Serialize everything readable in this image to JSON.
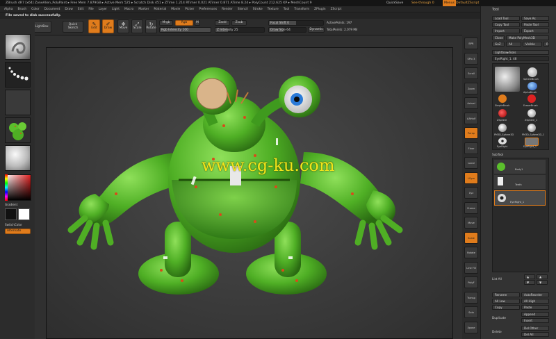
{
  "title_bar": {
    "text": "ZBrush 4R7 [x64]     ZoneAlien_PolyPaint     ▸ Free Mem 7.879GB ▸ Active Mem 525 ▸ Scratch Disk 451 ▸ ZTime 1.214 RTimer 0.021 ATimer 0.871 ATime 8.24 ▸ PolyCount 212.625 KP ▸ MeshCount 9",
    "quicksave": "QuickSave",
    "see_through": "See-through  0",
    "menus": "Menus",
    "default_script": "DefaultZScript"
  },
  "menu_bar": [
    "Alpha",
    "Brush",
    "Color",
    "Document",
    "Draw",
    "Edit",
    "File",
    "Layer",
    "Light",
    "Macro",
    "Marker",
    "Material",
    "Movie",
    "Picker",
    "Preferences",
    "Render",
    "Stencil",
    "Stroke",
    "Texture",
    "Tool",
    "Transform",
    "ZPlugin",
    "ZScript"
  ],
  "notice": "File saved to disk successfully.",
  "top_shelf": {
    "projection_master": "Projection Master",
    "lightbox": "LightBox",
    "quick_sketch": "Quick Sketch",
    "edit": "Edit",
    "draw": "Draw",
    "move": "Move",
    "scale": "Scale",
    "rotate": "Rotate",
    "mrgb": "Mrgb",
    "rgb": "Rgb",
    "m": "M",
    "rgb_intensity": "Rgb Intensity 100",
    "zadd": "Zadd",
    "zsub": "Zsub",
    "z_intensity": "Z Intensity 25",
    "focal_shift": "Focal Shift 0",
    "draw_size": "Draw Size 64",
    "dynamic": "Dynamic",
    "active_points": "ActivePoints: 197",
    "total_points": "TotalPoints: 2.079 Mil"
  },
  "left_panel": {
    "gradient": "Gradient",
    "switch_color": "SwitchColor",
    "alternate": "Alternate"
  },
  "watermark": "www.cg-ku.com",
  "right_shelf": [
    "BPR",
    "SPix 3",
    "Scroll",
    "Zoom",
    "Actual",
    "AAHalf",
    "Persp",
    "Floor",
    "Local",
    "LSym",
    "Xyz",
    "Frame",
    "Move",
    "Scale",
    "Rotate",
    "Line Fill",
    "PolyF",
    "Transp",
    "Solo",
    "Xpose"
  ],
  "tool_panel": {
    "header": "Tool",
    "load_tool": "Load Tool",
    "save_as": "Save As",
    "copy_tool": "Copy Tool",
    "paste_tool": "Paste Tool",
    "import": "Import",
    "export": "Export",
    "clone": "Clone",
    "make_polymesh": "Make PolyMesh3D",
    "goz": "GoZ",
    "all": "All",
    "visible": "Visible",
    "r": "R",
    "lightbox_tools": "Lightbox▸Tools",
    "current_tool": "EyeRight_1. 48",
    "tool_names": [
      "SphereBrush",
      "AlphaBrush",
      "SimpleBrush",
      "EraserBrush",
      "ZSphere",
      "ZSphere_1",
      "PM3D_Sphere3D",
      "PM3D_Sphere3D_1",
      "EyeRight",
      "EyeRight_1"
    ],
    "subtool_header": "SubTool",
    "subtools": [
      "Body1",
      "Teeth",
      "EyeRight_1"
    ],
    "list_all": "List All",
    "rename": "Rename",
    "auto_reorder": "AutoReorder",
    "all_low": "All Low",
    "all_high": "All High",
    "copy": "Copy",
    "paste": "Paste",
    "duplicate": "Duplicate",
    "append": "Append",
    "insert": "Insert",
    "delete": "Delete",
    "del_other": "Del Other",
    "del_all": "Del All"
  },
  "colors": {
    "accent_orange": "#e07c1c",
    "creature_green": "#5bbf2c",
    "watermark_yellow": "#f2e51a",
    "background": "#2a2a2a"
  }
}
